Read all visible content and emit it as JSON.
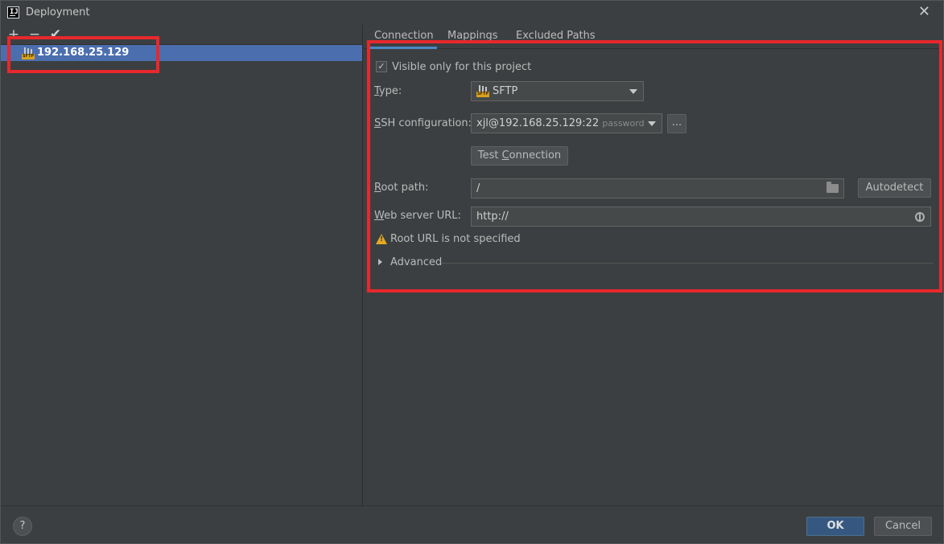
{
  "window": {
    "title": "Deployment",
    "app_icon_text": "IJ"
  },
  "toolbar": {
    "add": "+",
    "remove": "−",
    "check": "✔"
  },
  "servers": [
    {
      "label": "192.168.25.129",
      "type_badge": "SFTP"
    }
  ],
  "tabs": [
    "Connection",
    "Mappings",
    "Excluded Paths"
  ],
  "form": {
    "visible_checkbox": {
      "label": "Visible only for this project",
      "checked": true
    },
    "type": {
      "label_u": "T",
      "label_rest": "ype:",
      "value": "SFTP"
    },
    "ssh": {
      "label_u": "S",
      "label_rest": "SH configuration:",
      "value": "xjl@192.168.25.129:22",
      "hint": "password",
      "more": "..."
    },
    "test_connection": {
      "pre": "Test ",
      "u": "C",
      "post": "onnection"
    },
    "root_path": {
      "label_u": "R",
      "label_rest": "oot path:",
      "value": "/",
      "autodetect": "Autodetect"
    },
    "web_url": {
      "label_u": "W",
      "label_rest": "eb server URL:",
      "value": "http://"
    },
    "warning": "Root URL is not specified",
    "advanced": "Advanced"
  },
  "footer": {
    "help": "?",
    "ok": "OK",
    "cancel": "Cancel"
  },
  "colors": {
    "accent": "#4a88c7",
    "selection": "#4b6eaf",
    "highlight": "#e8282c",
    "warning": "#e5a823"
  }
}
